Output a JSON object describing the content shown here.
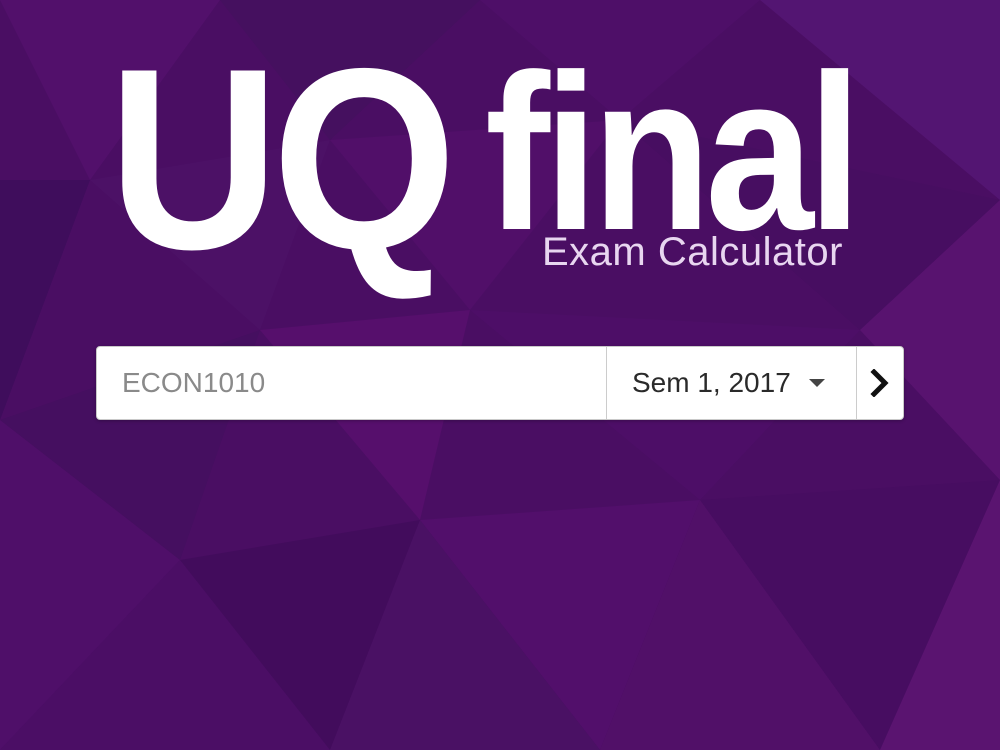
{
  "header": {
    "logo_main": "UQ",
    "logo_word": "final",
    "subtitle": "Exam Calculator"
  },
  "search": {
    "course_placeholder": "ECON1010",
    "semester_value": "Sem 1, 2017",
    "submit_icon": "chevron-right-icon",
    "dropdown_icon": "caret-down-icon"
  },
  "colors": {
    "background": "#4a0e63",
    "background_accent": "#5a1470",
    "text_on_background": "#ffffff",
    "subtitle": "#e8d6f0",
    "input_background": "#ffffff"
  }
}
